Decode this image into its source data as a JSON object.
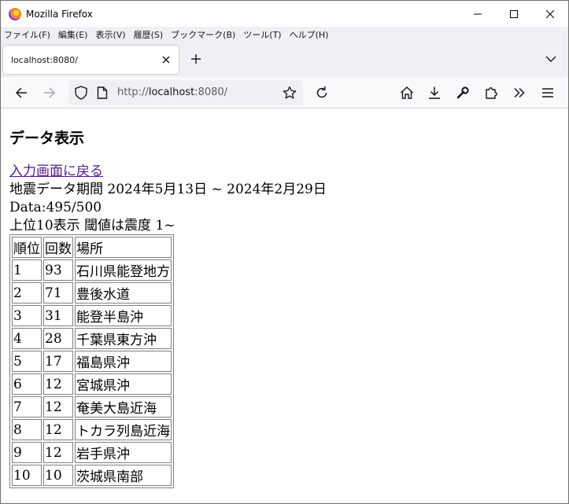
{
  "window": {
    "app_title": "Mozilla Firefox"
  },
  "menubar": {
    "items": [
      "ファイル(F)",
      "編集(E)",
      "表示(V)",
      "履歴(S)",
      "ブックマーク(B)",
      "ツール(T)",
      "ヘルプ(H)"
    ]
  },
  "tabs": [
    {
      "title": "localhost:8080/",
      "active": true
    }
  ],
  "navbar": {
    "url_scheme": "http://",
    "url_host": "localhost",
    "url_rest": ":8080/"
  },
  "page": {
    "heading": "データ表示",
    "back_link": "入力画面に戻る",
    "period": "地震データ期間 2024年5月13日 ~ 2024年2月29日",
    "data_count": "Data:495/500",
    "threshold": "上位10表示 閾値は震度 1~",
    "table": {
      "headers": [
        "順位",
        "回数",
        "場所"
      ],
      "rows": [
        [
          "1",
          "93",
          "石川県能登地方"
        ],
        [
          "2",
          "71",
          "豊後水道"
        ],
        [
          "3",
          "31",
          "能登半島沖"
        ],
        [
          "4",
          "28",
          "千葉県東方沖"
        ],
        [
          "5",
          "17",
          "福島県沖"
        ],
        [
          "6",
          "12",
          "宮城県沖"
        ],
        [
          "7",
          "12",
          "奄美大島近海"
        ],
        [
          "8",
          "12",
          "トカラ列島近海"
        ],
        [
          "9",
          "12",
          "岩手県沖"
        ],
        [
          "10",
          "10",
          "茨城県南部"
        ]
      ]
    }
  },
  "colors": {
    "link_visited": "#551a8b",
    "toolbar_bg": "#f0f0f4",
    "table_border": "#808080"
  }
}
